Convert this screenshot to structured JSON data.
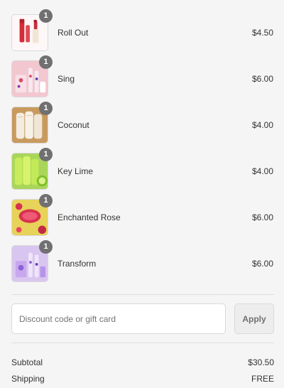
{
  "items": [
    {
      "name": "Roll Out",
      "price": "$4.50",
      "quantity": "1",
      "image": "red-lip-gloss-tubes"
    },
    {
      "name": "Sing",
      "price": "$6.00",
      "quantity": "1",
      "image": "pink-lip-balm-set"
    },
    {
      "name": "Coconut",
      "price": "$4.00",
      "quantity": "1",
      "image": "coconut-sticks"
    },
    {
      "name": "Key Lime",
      "price": "$4.00",
      "quantity": "1",
      "image": "key-lime-sticks"
    },
    {
      "name": "Enchanted Rose",
      "price": "$6.00",
      "quantity": "1",
      "image": "enchanted-rose-balm"
    },
    {
      "name": "Transform",
      "price": "$6.00",
      "quantity": "1",
      "image": "purple-lip-balm-set"
    }
  ],
  "discount": {
    "placeholder": "Discount code or gift card",
    "apply_label": "Apply"
  },
  "summary": {
    "subtotal_label": "Subtotal",
    "subtotal_value": "$30.50",
    "shipping_label": "Shipping",
    "shipping_value": "FREE"
  },
  "colors": {
    "background": "#f5f5f5",
    "badge": "#707070",
    "border": "#d9d9d9",
    "text": "#333333"
  }
}
